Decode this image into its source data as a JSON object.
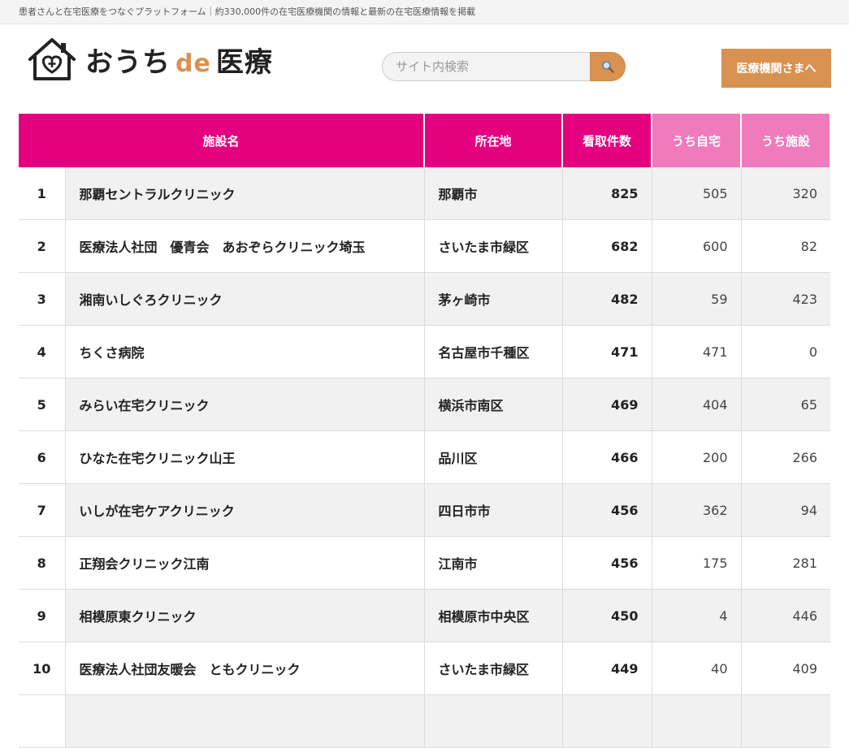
{
  "topbar": {
    "tagline": "患者さんと在宅医療をつなぐプラットフォーム｜約330,000件の在宅医療機関の情報と最新の在宅医療情報を掲載"
  },
  "header": {
    "logo_text_a": "おうち",
    "logo_text_de": "de",
    "logo_text_b": "医療",
    "search_placeholder": "サイト内検索",
    "medical_button": "医療機関さまへ"
  },
  "colors": {
    "accent_orange": "#d99150",
    "header_pink": "#e4007f",
    "header_light_pink": "#ef7bbd"
  },
  "table": {
    "headers": {
      "name": "施設名",
      "location": "所在地",
      "total": "看取件数",
      "home": "うち自宅",
      "facility": "うち施設"
    },
    "rows": [
      {
        "rank": "1",
        "name": "那覇セントラルクリニック",
        "location": "那覇市",
        "total": "825",
        "home": "505",
        "facility": "320"
      },
      {
        "rank": "2",
        "name": "医療法人社団　優青会　あおぞらクリニック埼玉",
        "location": "さいたま市緑区",
        "total": "682",
        "home": "600",
        "facility": "82"
      },
      {
        "rank": "3",
        "name": "湘南いしぐろクリニック",
        "location": "茅ヶ崎市",
        "total": "482",
        "home": "59",
        "facility": "423"
      },
      {
        "rank": "4",
        "name": "ちくさ病院",
        "location": "名古屋市千種区",
        "total": "471",
        "home": "471",
        "facility": "0"
      },
      {
        "rank": "5",
        "name": "みらい在宅クリニック",
        "location": "横浜市南区",
        "total": "469",
        "home": "404",
        "facility": "65"
      },
      {
        "rank": "6",
        "name": "ひなた在宅クリニック山王",
        "location": "品川区",
        "total": "466",
        "home": "200",
        "facility": "266"
      },
      {
        "rank": "7",
        "name": "いしが在宅ケアクリニック",
        "location": "四日市市",
        "total": "456",
        "home": "362",
        "facility": "94"
      },
      {
        "rank": "8",
        "name": "正翔会クリニック江南",
        "location": "江南市",
        "total": "456",
        "home": "175",
        "facility": "281"
      },
      {
        "rank": "9",
        "name": "相模原東クリニック",
        "location": "相模原市中央区",
        "total": "450",
        "home": "4",
        "facility": "446"
      },
      {
        "rank": "10",
        "name": "医療法人社団友暖会　ともクリニック",
        "location": "さいたま市緑区",
        "total": "449",
        "home": "40",
        "facility": "409"
      }
    ]
  }
}
